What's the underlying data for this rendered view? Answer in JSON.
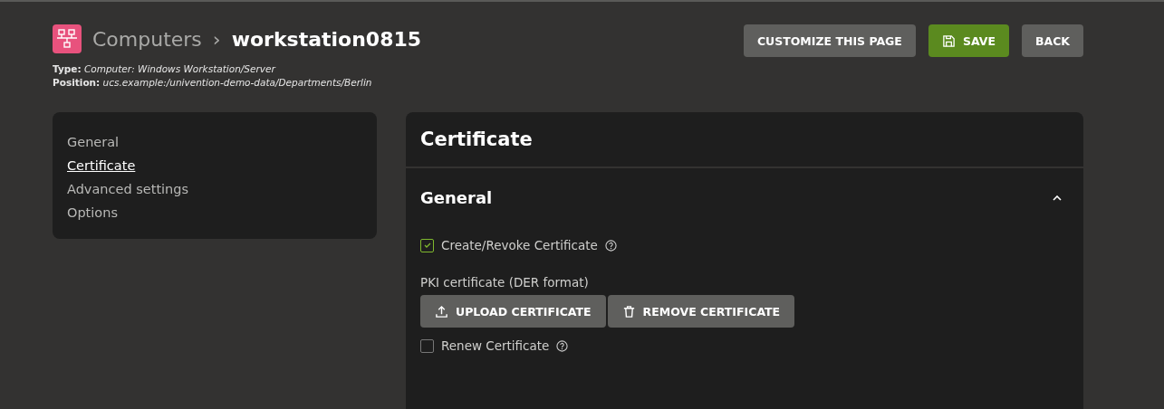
{
  "header": {
    "breadcrumb": "Computers",
    "separator": "›",
    "title": "workstation0815",
    "meta": [
      "**Type:** *Computer: Windows Workstation/Server*",
      "**Position:** *ucs.example:/univention-demo-data/Departments/Berlin*"
    ]
  },
  "actions": [
    {
      "label": "CUSTOMIZE THIS PAGE",
      "kind": "plain"
    },
    {
      "label": "SAVE",
      "kind": "primary"
    },
    {
      "label": "BACK",
      "kind": "plain"
    }
  ],
  "sidebar": {
    "items": [
      {
        "label": "General",
        "selected": false
      },
      {
        "label": "Certificate",
        "selected": true
      },
      {
        "label": "Advanced settings",
        "selected": false
      },
      {
        "label": "Options",
        "selected": false
      }
    ]
  },
  "panel": {
    "title": "Certificate",
    "section": {
      "title": "General",
      "expanded": true,
      "fields": [
        {
          "kind": "checkbox",
          "label": "Create/Revoke Certificate",
          "checked": true
        },
        {
          "kind": "file",
          "label": "PKI certificate (DER format)",
          "buttons": [
            {
              "label": "UPLOAD CERTIFICATE",
              "kind": "upload"
            },
            {
              "label": "REMOVE CERTIFICATE",
              "kind": "remove"
            }
          ]
        },
        {
          "kind": "checkbox",
          "label": "Renew Certificate",
          "checked": false
        }
      ]
    }
  }
}
